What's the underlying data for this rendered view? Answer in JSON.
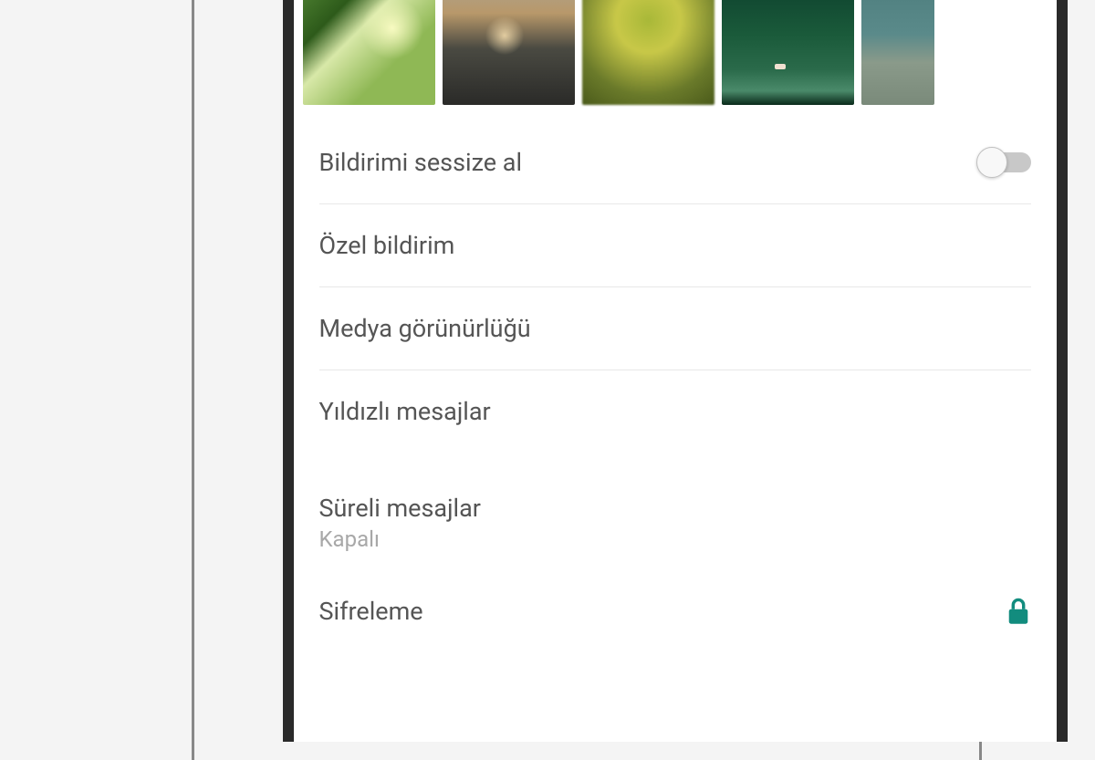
{
  "media": {
    "thumbnails": [
      "palm",
      "sunset",
      "yellow-leaves",
      "forest",
      "ocean"
    ]
  },
  "settings": {
    "mute_notifications": {
      "label": "Bildirimi sessize al",
      "enabled": false
    },
    "custom_notifications": {
      "label": "Özel bildirim"
    },
    "media_visibility": {
      "label": "Medya görünürlüğü"
    },
    "starred_messages": {
      "label": "Yıldızlı mesajlar"
    },
    "disappearing_messages": {
      "label": "Süreli mesajlar",
      "value": "Kapalı"
    },
    "encryption": {
      "label": "Sifreleme"
    }
  },
  "colors": {
    "accent": "#128c7e",
    "text_primary": "#555555",
    "text_secondary": "#a8a8a8"
  }
}
